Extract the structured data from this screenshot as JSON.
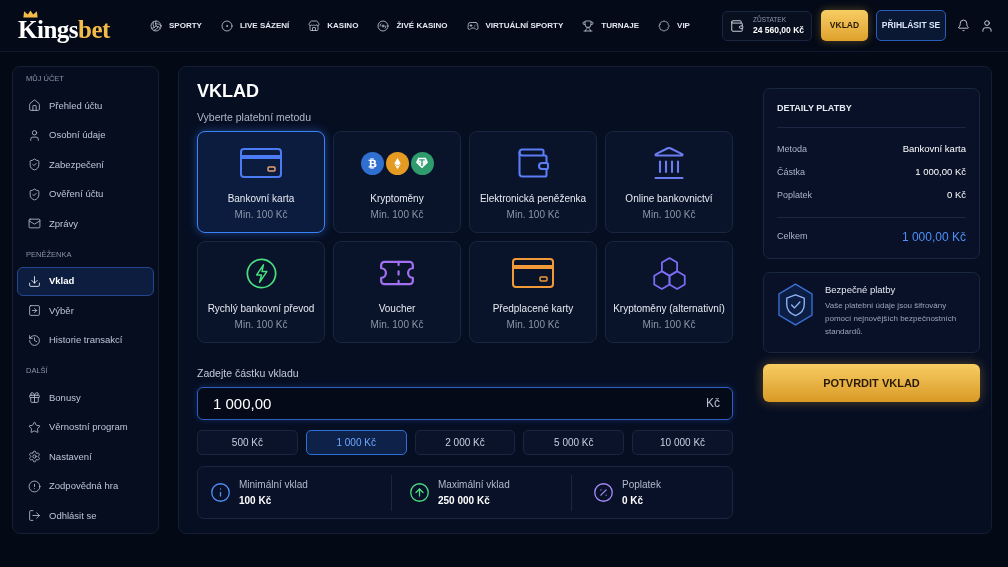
{
  "header": {
    "logo": {
      "primary": "Kings",
      "accent": "bet"
    },
    "nav": [
      {
        "label": "SPORTY"
      },
      {
        "label": "LIVE SÁZENÍ"
      },
      {
        "label": "KASINO"
      },
      {
        "label": "ŽIVÉ KASINO"
      },
      {
        "label": "VIRTUÁLNÍ SPORTY"
      },
      {
        "label": "TURNAJE"
      },
      {
        "label": "VIP"
      }
    ],
    "balance": {
      "label": "ZŮSTATEK",
      "value": "24 560,00 Kč"
    },
    "deposit_button": "VKLAD",
    "login_button": "PŘIHLÁSIT SE"
  },
  "sidebar": {
    "sections": [
      {
        "title": "MŮJ ÚČET",
        "items": [
          {
            "label": "Přehled účtu",
            "selected": false
          },
          {
            "label": "Osobní údaje",
            "selected": false
          },
          {
            "label": "Zabezpečení",
            "selected": false
          },
          {
            "label": "Ověření účtu",
            "selected": false
          },
          {
            "label": "Zprávy",
            "selected": false
          }
        ]
      },
      {
        "title": "PENĚŽENKA",
        "items": [
          {
            "label": "Vklad",
            "selected": true
          },
          {
            "label": "Výběr",
            "selected": false
          },
          {
            "label": "Historie transakcí",
            "selected": false
          }
        ]
      },
      {
        "title": "DALŠÍ",
        "items": [
          {
            "label": "Bonusy",
            "selected": false
          },
          {
            "label": "Věrnostní program",
            "selected": false
          },
          {
            "label": "Nastavení",
            "selected": false
          },
          {
            "label": "Zodpovědná hra",
            "selected": false
          },
          {
            "label": "Odhlásit se",
            "selected": false
          }
        ]
      }
    ]
  },
  "deposit": {
    "title": "VKLAD",
    "subtitle": "Vyberte platební metodu",
    "methods": [
      {
        "name": "Bankovní karta",
        "min": "Min. 100 Kč",
        "selected": true
      },
      {
        "name": "Kryptoměny",
        "min": "Min. 100 Kč",
        "selected": false
      },
      {
        "name": "Elektronická peněženka",
        "min": "Min. 100 Kč",
        "selected": false
      },
      {
        "name": "Online bankovnictví",
        "min": "Min. 100 Kč",
        "selected": false
      },
      {
        "name": "Rychlý bankovní převod",
        "min": "Min. 100 Kč",
        "selected": false
      },
      {
        "name": "Voucher",
        "min": "Min. 100 Kč",
        "selected": false
      },
      {
        "name": "Předplacené karty",
        "min": "Min. 100 Kč",
        "selected": false
      },
      {
        "name": "Kryptoměny (alternativní)",
        "min": "Min. 100 Kč",
        "selected": false
      }
    ],
    "amount": {
      "label": "Zadejte částku vkladu",
      "value": "1 000,00",
      "currency": "Kč"
    },
    "quick_amounts": [
      {
        "label": "500 Kč",
        "selected": false
      },
      {
        "label": "1 000 Kč",
        "selected": true
      },
      {
        "label": "2 000 Kč",
        "selected": false
      },
      {
        "label": "5 000 Kč",
        "selected": false
      },
      {
        "label": "10 000 Kč",
        "selected": false
      }
    ],
    "limits": [
      {
        "label": "Minimální vklad",
        "value": "100 Kč"
      },
      {
        "label": "Maximální vklad",
        "value": "250 000 Kč"
      },
      {
        "label": "Poplatek",
        "value": "0 Kč"
      }
    ]
  },
  "details": {
    "title": "DETAILY PLATBY",
    "rows": [
      {
        "label": "Metoda",
        "value": "Bankovní karta"
      },
      {
        "label": "Částka",
        "value": "1 000,00 Kč"
      },
      {
        "label": "Poplatek",
        "value": "0 Kč"
      }
    ],
    "total": {
      "label": "Celkem",
      "value": "1 000,00 Kč"
    }
  },
  "security": {
    "title": "Bezpečné platby",
    "text": "Vaše platební údaje jsou šifrovány pomocí nejnovějších bezpečnostních standardů."
  },
  "confirm_button": "POTVRDIT VKLAD"
}
